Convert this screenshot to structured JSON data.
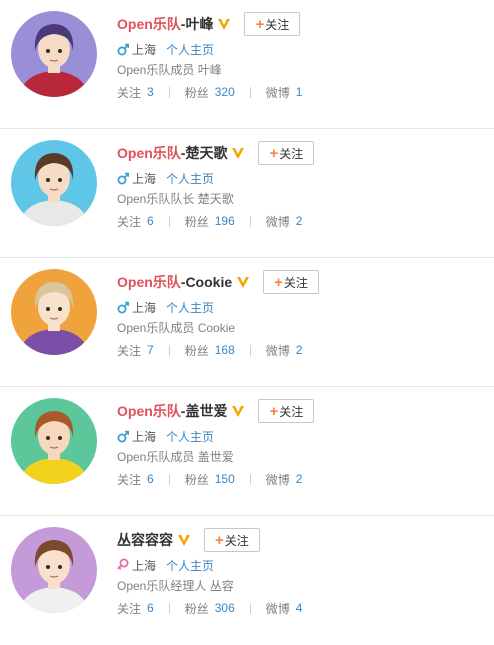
{
  "colors": {
    "band_red": "#e0515b",
    "link_blue": "#3b86c4",
    "male": "#3b9fd6",
    "female": "#e46fa6",
    "verified": "#f5a500",
    "follow_plus": "#ff8140"
  },
  "users": [
    {
      "name_prefix": "Open乐队",
      "name_suffix": "-叶峰",
      "gender": "male",
      "location": "上海",
      "homepage": "个人主页",
      "desc": "Open乐队成员 叶峰",
      "follow_label": "关注",
      "stats": {
        "following_label": "关注",
        "following": "3",
        "fans_label": "粉丝",
        "fans": "320",
        "posts_label": "微博",
        "posts": "1"
      },
      "avatar": {
        "bg": "#9a8fd6",
        "hair": "#4a3a7c",
        "skin": "#f4dcc6",
        "cloth": "#b8283a"
      }
    },
    {
      "name_prefix": "Open乐队",
      "name_suffix": "-楚天歌",
      "gender": "male",
      "location": "上海",
      "homepage": "个人主页",
      "desc": "Open乐队队长 楚天歌",
      "follow_label": "关注",
      "stats": {
        "following_label": "关注",
        "following": "6",
        "fans_label": "粉丝",
        "fans": "196",
        "posts_label": "微博",
        "posts": "2"
      },
      "avatar": {
        "bg": "#5fc6e8",
        "hair": "#5a3a26",
        "skin": "#f6dcc4",
        "cloth": "#e8e8e8"
      }
    },
    {
      "name_prefix": "Open乐队",
      "name_suffix": "-Cookie",
      "gender": "male",
      "location": "上海",
      "homepage": "个人主页",
      "desc": "Open乐队成员 Cookie",
      "follow_label": "关注",
      "stats": {
        "following_label": "关注",
        "following": "7",
        "fans_label": "粉丝",
        "fans": "168",
        "posts_label": "微博",
        "posts": "2"
      },
      "avatar": {
        "bg": "#f0a23c",
        "hair": "#d8c79a",
        "skin": "#f7e2cc",
        "cloth": "#7b4fa8"
      }
    },
    {
      "name_prefix": "Open乐队",
      "name_suffix": "-盖世爱",
      "gender": "male",
      "location": "上海",
      "homepage": "个人主页",
      "desc": "Open乐队成员 盖世爱",
      "follow_label": "关注",
      "stats": {
        "following_label": "关注",
        "following": "6",
        "fans_label": "粉丝",
        "fans": "150",
        "posts_label": "微博",
        "posts": "2"
      },
      "avatar": {
        "bg": "#5cc79a",
        "hair": "#a85a2a",
        "skin": "#f6d8bc",
        "cloth": "#f2d21c"
      }
    },
    {
      "name_prefix": "",
      "name_suffix": "丛容容容",
      "gender": "female",
      "location": "上海",
      "homepage": "个人主页",
      "desc": "Open乐队经理人 丛容",
      "follow_label": "关注",
      "stats": {
        "following_label": "关注",
        "following": "6",
        "fans_label": "粉丝",
        "fans": "306",
        "posts_label": "微博",
        "posts": "4"
      },
      "avatar": {
        "bg": "#c59ad9",
        "hair": "#7a4a2c",
        "skin": "#f8e0cc",
        "cloth": "#f0f0f0"
      }
    }
  ]
}
